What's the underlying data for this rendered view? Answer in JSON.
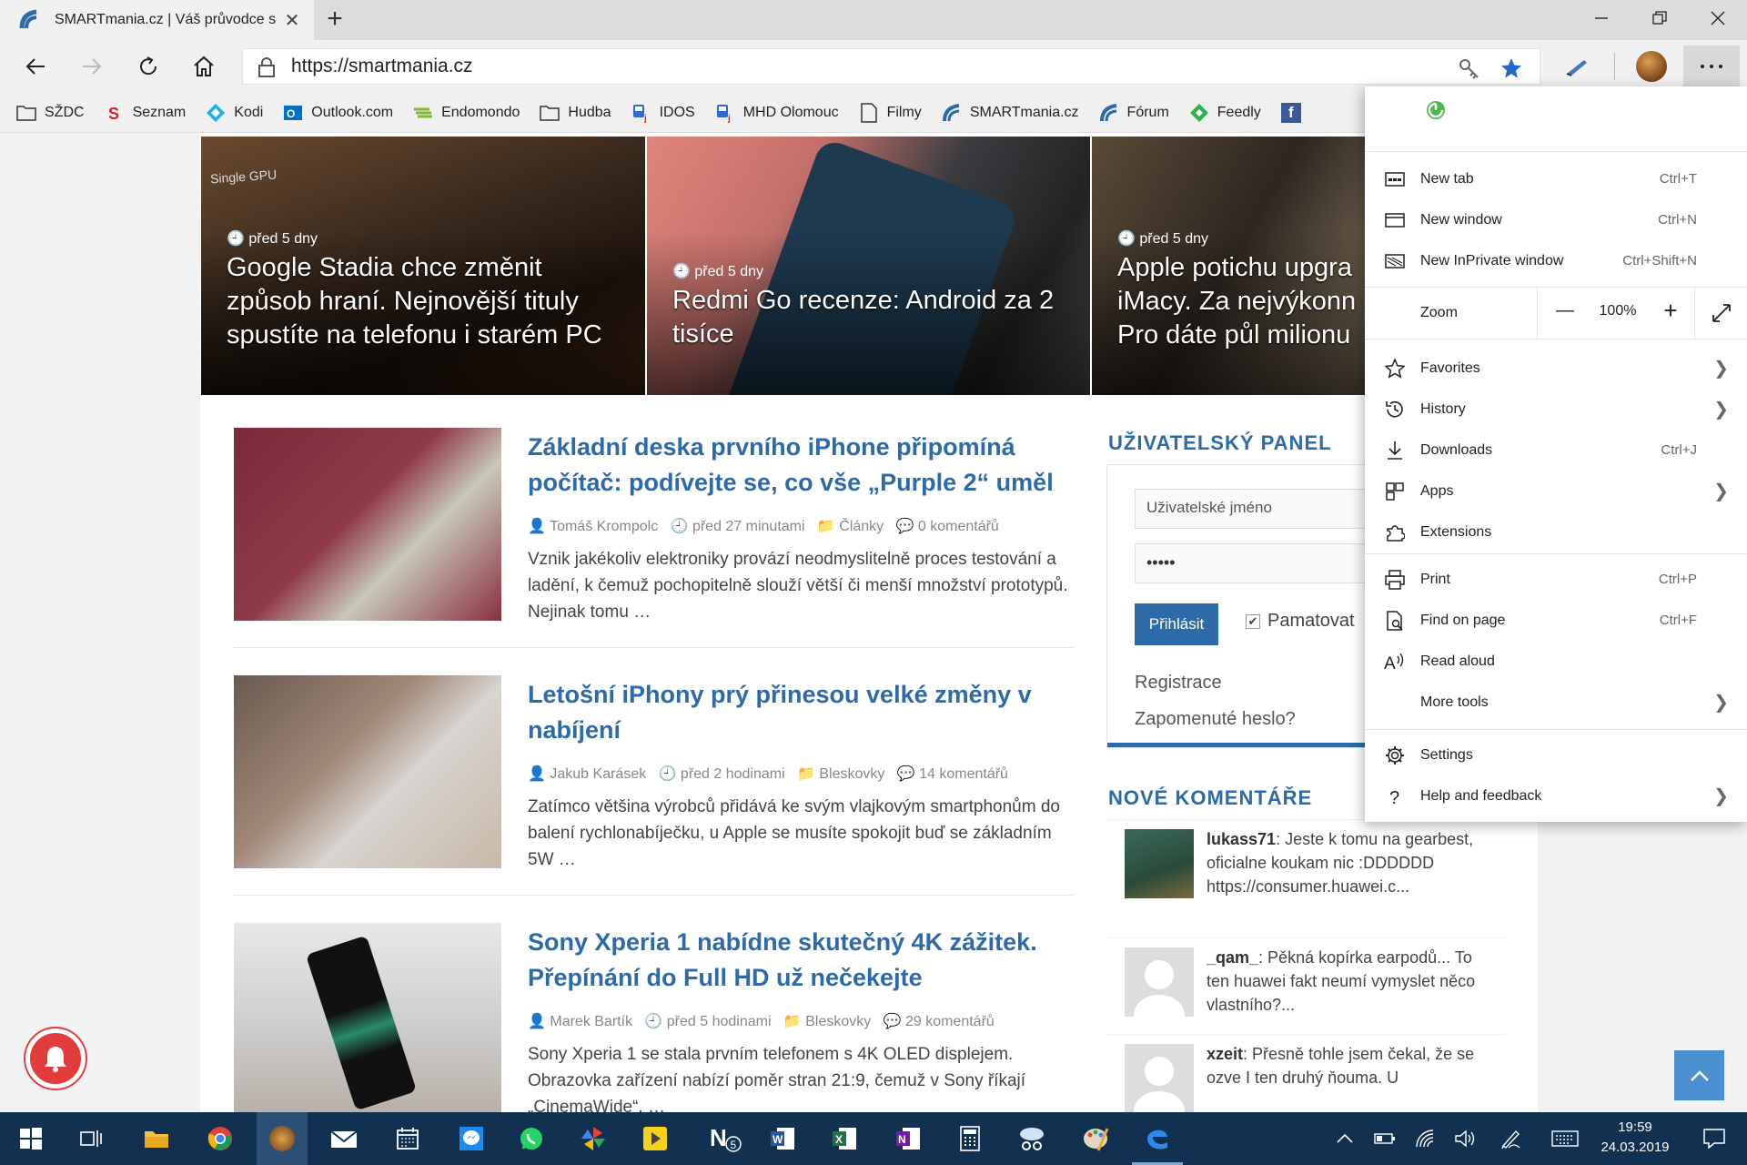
{
  "browser": {
    "tab_title": "SMARTmania.cz | Váš průvodce s",
    "tab_close": "✕",
    "new_tab": "+",
    "url": "https://smartmania.cz"
  },
  "favorites_bar": [
    {
      "label": "SŽDC",
      "icon": "folder-icon"
    },
    {
      "label": "Seznam",
      "icon": "seznam-icon"
    },
    {
      "label": "Kodi",
      "icon": "kodi-icon"
    },
    {
      "label": "Outlook.com",
      "icon": "outlook-icon"
    },
    {
      "label": "Endomondo",
      "icon": "endomondo-icon"
    },
    {
      "label": "Hudba",
      "icon": "folder-icon"
    },
    {
      "label": "IDOS",
      "icon": "idos-icon"
    },
    {
      "label": "MHD Olomouc",
      "icon": "idos-icon"
    },
    {
      "label": "Filmy",
      "icon": "page-icon"
    },
    {
      "label": "SMARTmania.cz",
      "icon": "smartmania-icon"
    },
    {
      "label": "Fórum",
      "icon": "smartmania-icon"
    },
    {
      "label": "Feedly",
      "icon": "feedly-icon"
    }
  ],
  "hero": [
    {
      "time": "před 5 dny",
      "title": "Google Stadia chce změnit způsob hraní. Nejnovější tituly spustíte na telefonu i starém PC",
      "overlay": "Single GPU"
    },
    {
      "time": "před 5 dny",
      "title": "Redmi Go recenze: Android za 2 tisíce"
    },
    {
      "time": "před 5 dny",
      "title": "Apple potichu upgra iMacy. Za nejvýkonn Pro dáte půl milionu"
    }
  ],
  "articles": [
    {
      "title": "Základní deska prvního iPhone připomíná počítač: podívejte se, co vše „Purple 2“ uměl",
      "author": "Tomáš Krompolc",
      "time": "před 27 minutami",
      "category": "Články",
      "comments": "0 komentářů",
      "excerpt": "Vznik jakékoliv elektroniky provází neodmyslitelně proces testování a ladění, k čemuž pochopitelně slouží větší či menší množství prototypů. Nejinak tomu …"
    },
    {
      "title": "Letošní iPhony prý přinesou velké změny v nabíjení",
      "author": "Jakub Karásek",
      "time": "před 2 hodinami",
      "category": "Bleskovky",
      "comments": "14 komentářů",
      "excerpt": "Zatímco většina výrobců přidává ke svým vlajkovým smartphonům do balení rychlonabíječku, u Apple se musíte spokojit buď se základním 5W …"
    },
    {
      "title": "Sony Xperia 1 nabídne skutečný 4K zážitek. Přepínání do Full HD už nečekejte",
      "author": "Marek Bartík",
      "time": "před 5 hodinami",
      "category": "Bleskovky",
      "comments": "29 komentářů",
      "excerpt": "Sony Xperia 1 se stala prvním telefonem s 4K OLED displejem. Obrazovka zařízení nabízí poměr stran 21:9, čemuž v Sony říkají „CinemaWide“. …"
    }
  ],
  "user_panel": {
    "heading": "UŽIVATELSKÝ PANEL",
    "username_placeholder": "Uživatelské jméno",
    "password_value": "•••••",
    "login": "Přihlásit",
    "remember": "Pamatovat",
    "register": "Registrace",
    "forgot": "Zapomenuté heslo?"
  },
  "comments_widget": {
    "heading": "NOVÉ KOMENTÁŘE",
    "items": [
      {
        "user": "lukass71",
        "text": ": Jeste k tomu na gearbest, oficialne koukam nic :DDDDDD https://consumer.huawei.c..."
      },
      {
        "user": "_qam_",
        "text": ": Pěkná kopírka earpodů... To ten huawei fakt neumí vymyslet něco vlastního?..."
      },
      {
        "user": "xzeit",
        "text": ": Přesně tohle jsem čekal, že se ozve I ten druhý ňouma. U"
      }
    ]
  },
  "menu": {
    "items": [
      {
        "label": "New tab",
        "shortcut": "Ctrl+T",
        "icon": "new-tab-icon"
      },
      {
        "label": "New window",
        "shortcut": "Ctrl+N",
        "icon": "new-window-icon"
      },
      {
        "label": "New InPrivate window",
        "shortcut": "Ctrl+Shift+N",
        "icon": "inprivate-icon"
      }
    ],
    "zoom_label": "Zoom",
    "zoom_value": "100%",
    "zoom_minus": "—",
    "zoom_plus": "+",
    "items2": [
      {
        "label": "Favorites",
        "icon": "star-outline-icon",
        "chevron": "❯"
      },
      {
        "label": "History",
        "icon": "history-icon",
        "chevron": "❯"
      },
      {
        "label": "Downloads",
        "shortcut": "Ctrl+J",
        "icon": "download-icon"
      },
      {
        "label": "Apps",
        "icon": "apps-icon",
        "chevron": "❯"
      },
      {
        "label": "Extensions",
        "icon": "extensions-icon"
      }
    ],
    "items3": [
      {
        "label": "Print",
        "shortcut": "Ctrl+P",
        "icon": "print-icon"
      },
      {
        "label": "Find on page",
        "shortcut": "Ctrl+F",
        "icon": "find-icon"
      },
      {
        "label": "Read aloud",
        "icon": "read-aloud-icon"
      },
      {
        "label": "More tools",
        "icon": "",
        "chevron": "❯"
      }
    ],
    "items4": [
      {
        "label": "Settings",
        "icon": "gear-icon"
      },
      {
        "label": "Help and feedback",
        "icon": "help-icon",
        "chevron": "❯"
      }
    ]
  },
  "taskbar": {
    "time": "19:59",
    "date": "24.03.2019"
  },
  "colors": {
    "link": "#2d6aa8",
    "taskbar": "#12304f",
    "menu_bg": "#ffffff"
  }
}
